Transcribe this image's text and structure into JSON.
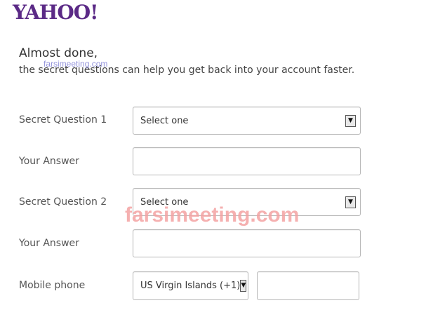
{
  "brand": {
    "logo_text": "YAHOO!"
  },
  "header": {
    "title": "Almost done,",
    "subtitle": "the secret questions can help you get back into your account faster."
  },
  "watermarks": {
    "small": "farsimeeting.com",
    "large": "farsimeeting.com"
  },
  "form": {
    "secret_question_1": {
      "label": "Secret Question 1",
      "selected": "Select one"
    },
    "answer_1": {
      "label": "Your Answer",
      "value": ""
    },
    "secret_question_2": {
      "label": "Secret Question 2",
      "selected": "Select one"
    },
    "answer_2": {
      "label": "Your Answer",
      "value": ""
    },
    "mobile_phone": {
      "label": "Mobile phone",
      "country_selected": "US Virgin Islands (+1)",
      "number_value": ""
    }
  },
  "icons": {
    "dropdown": "chevron-down-icon"
  },
  "colors": {
    "brand": "#5b2a86",
    "watermark_small": "#6f6fcf",
    "watermark_large": "#f4a3a3"
  }
}
